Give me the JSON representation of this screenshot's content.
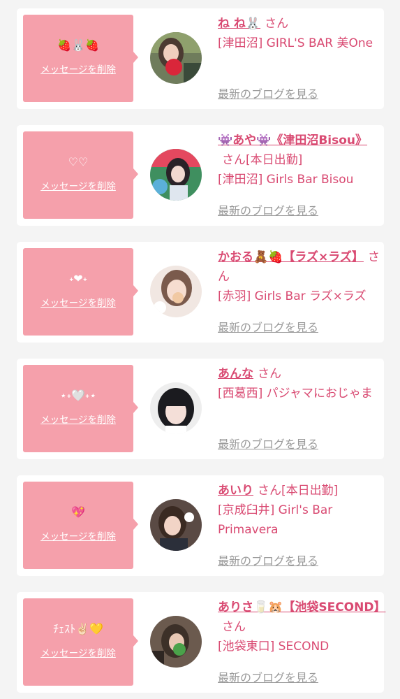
{
  "delete_label": "メッセージを削除",
  "san_label": "さん",
  "blog_label": "最新のブログを見る",
  "accent_color": "#d94a72",
  "bubble_color": "#f5a0ab",
  "cards": [
    {
      "bubble_text": "🍓🐰🍓",
      "name": "ね ね🐰",
      "suffix": "",
      "shop": "[津田沼] GIRL'S BAR 美One"
    },
    {
      "bubble_text": "♡♡",
      "name": "👾あや👾《津田沼Bisou》",
      "suffix": "[本日出勤]",
      "shop": "[津田沼] Girls Bar Bisou"
    },
    {
      "bubble_text": "˖❤︎˖",
      "name": "かおる🧸🍓【ラズ×ラズ】",
      "suffix": "",
      "shop": "[赤羽] Girls Bar ラズ×ラズ"
    },
    {
      "bubble_text": "⋆˖🤍˖⋆",
      "name": "あんな",
      "suffix": "",
      "shop": "[西葛西] パジャマにおじゃま"
    },
    {
      "bubble_text": "💖",
      "name": "あいり",
      "suffix": "[本日出勤]",
      "shop": "[京成臼井] Girl's Bar Primavera"
    },
    {
      "bubble_text": "ﾁｪｽﾄ✌🏻💛",
      "name": "ありさ🥛🐹【池袋SECOND】",
      "suffix": "",
      "shop": "[池袋東口] SECOND"
    }
  ]
}
